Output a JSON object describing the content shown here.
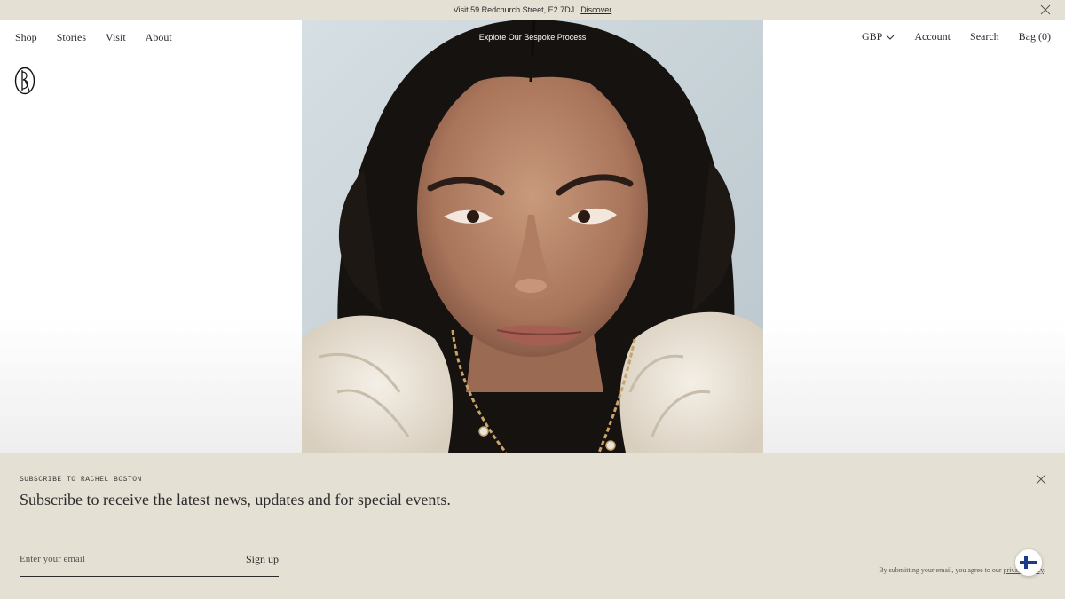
{
  "announcement": {
    "text": "Visit 59 Redchurch Street, E2 7DJ",
    "link": "Discover"
  },
  "nav": {
    "left": [
      "Shop",
      "Stories",
      "Visit",
      "About"
    ],
    "currency": "GBP",
    "account": "Account",
    "search": "Search",
    "bag": "Bag (0)"
  },
  "hero": {
    "cta": "Explore Our Bespoke Process"
  },
  "subscribe": {
    "eyebrow": "SUBSCRIBE TO RACHEL BOSTON",
    "heading": "Subscribe to receive the latest news, updates and for special events.",
    "email_placeholder": "Enter your email",
    "submit_label": "Sign up",
    "disclaimer_text": "By submitting your email, you agree to our",
    "disclaimer_link": "privacy policy",
    "disclaimer_end": "."
  },
  "colors": {
    "panel_bg": "#e5e0d4",
    "text": "#2b2b2b",
    "flag_blue": "#1a3a8a"
  },
  "icons": {
    "close": "close-icon",
    "currency_dropdown": "chevron-down-icon",
    "brand": "rb-monogram-logo",
    "flag": "finland-flag-icon"
  }
}
